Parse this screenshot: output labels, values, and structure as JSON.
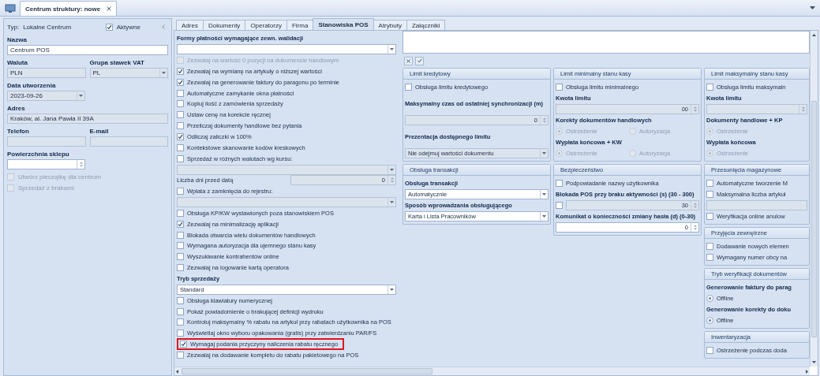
{
  "window": {
    "document_tab": "Centrum struktury: nowe"
  },
  "sidebar": {
    "type_label": "Typ:",
    "type_value": "Lokalne Centrum",
    "active": {
      "label": "Aktywne",
      "checked": true
    },
    "rows": [
      [
        {
          "kind": "text",
          "label": "Nazwa",
          "value": "Centrum POS",
          "disabled": false
        }
      ],
      [
        {
          "kind": "text",
          "label": "Waluta",
          "value": "PLN",
          "disabled": true
        },
        {
          "kind": "dropdown",
          "label": "Grupa stawek VAT",
          "value": "PL",
          "disabled": true
        }
      ],
      [
        {
          "kind": "date",
          "label": "Data utworzenia",
          "value": "2023-09-26",
          "disabled": true
        }
      ],
      [
        {
          "kind": "text",
          "label": "Adres",
          "value": "Kraków, al. Jana Pawła II 39A",
          "disabled": true
        }
      ],
      [
        {
          "kind": "text",
          "label": "Telefon",
          "disabled": true
        },
        {
          "kind": "text",
          "label": "E-mail",
          "disabled": true
        }
      ],
      [
        {
          "kind": "spinner",
          "label": "Powierzchnia sklepu",
          "disabled": false
        }
      ]
    ],
    "checkboxes": [
      {
        "label": "Utwórz pieczątkę dla centrum",
        "checked": false,
        "disabled": true
      },
      {
        "label": "Sprzedaż z brakami",
        "checked": false,
        "disabled": true
      }
    ]
  },
  "tabs": [
    {
      "label": "Adres",
      "selected": false
    },
    {
      "label": "Dokumenty",
      "selected": false
    },
    {
      "label": "Operatorzy",
      "selected": false
    },
    {
      "label": "Firma",
      "selected": false
    },
    {
      "label": "Stanowiska POS",
      "selected": true
    },
    {
      "label": "Atrybuty",
      "selected": false
    },
    {
      "label": "Załączniki",
      "selected": false
    }
  ],
  "settings": [
    {
      "kind": "label",
      "text": "Formy płatności wymagające zewn. walidacji"
    },
    {
      "kind": "dropdown",
      "disabled": false
    },
    {
      "kind": "checkbox",
      "label": "Zezwalaj na wartość 0 pozycji na dokumencie handlowym",
      "checked": false,
      "disabled": true,
      "highlighted": false
    },
    {
      "kind": "checkbox",
      "label": "Zezwalaj na wymianę na artykuły o niższej wartości",
      "checked": true,
      "disabled": false,
      "highlighted": false
    },
    {
      "kind": "checkbox",
      "label": "Zezwalaj na generowanie faktury do paragonu po terminie",
      "checked": true,
      "disabled": false,
      "highlighted": false
    },
    {
      "kind": "checkbox",
      "label": "Automatyczne zamykanie okna płatności",
      "checked": false,
      "disabled": false,
      "highlighted": false
    },
    {
      "kind": "checkbox",
      "label": "Kopiuj ilość z zamówienia sprzedaży",
      "checked": false,
      "disabled": false,
      "highlighted": false
    },
    {
      "kind": "checkbox",
      "label": "Ustaw cenę na korekcie ręcznej",
      "checked": false,
      "disabled": false,
      "highlighted": false
    },
    {
      "kind": "checkbox",
      "label": "Przeliczaj dokumenty handlowe bez pytania",
      "checked": false,
      "disabled": false,
      "highlighted": false
    },
    {
      "kind": "checkbox",
      "label": "Odliczaj zaliczki w 100%",
      "checked": true,
      "disabled": false,
      "highlighted": false
    },
    {
      "kind": "checkbox",
      "label": "Kontekstowe skanowanie kodów kreskowych",
      "checked": false,
      "disabled": false,
      "highlighted": false
    },
    {
      "kind": "checkbox",
      "label": "Sprzedaż w różnych walutach wg kursu:",
      "checked": false,
      "disabled": false,
      "highlighted": false
    },
    {
      "kind": "dropdown",
      "disabled": true
    },
    {
      "kind": "number",
      "label": "Liczba dni przed datą",
      "value": "0",
      "disabled": true
    },
    {
      "kind": "checkbox",
      "label": "Wpłata z zamknięcia do rejestru:",
      "checked": false,
      "disabled": false,
      "highlighted": false
    },
    {
      "kind": "dropdown",
      "disabled": true
    },
    {
      "kind": "checkbox",
      "label": "Obsługa KP/KW wystawionych poza stanowiskiem POS",
      "checked": false,
      "disabled": false,
      "highlighted": false
    },
    {
      "kind": "checkbox",
      "label": "Zezwalaj na minimalizację aplikacji",
      "checked": true,
      "disabled": false,
      "highlighted": false
    },
    {
      "kind": "checkbox",
      "label": "Blokada otwarcia wielu dokumentów handlowych",
      "checked": false,
      "disabled": false,
      "highlighted": false
    },
    {
      "kind": "checkbox",
      "label": "Wymagana autoryzacja dla ujemnego stanu kasy",
      "checked": false,
      "disabled": false,
      "highlighted": false
    },
    {
      "kind": "checkbox",
      "label": "Wyszukiwanie kontrahentów online",
      "checked": false,
      "disabled": false,
      "highlighted": false
    },
    {
      "kind": "checkbox",
      "label": "Zezwalaj na logowanie kartą operatora",
      "checked": false,
      "disabled": false,
      "highlighted": false
    },
    {
      "kind": "label",
      "text": "Tryb sprzedaży"
    },
    {
      "kind": "dropdown",
      "value": "Standard",
      "disabled": false
    },
    {
      "kind": "checkbox",
      "label": "Obsługa klawiatury numerycznej",
      "checked": false,
      "disabled": false,
      "highlighted": false
    },
    {
      "kind": "checkbox",
      "label": "Pokaż powiadomienie o brakującej definicji wydruku",
      "checked": false,
      "disabled": false,
      "highlighted": false
    },
    {
      "kind": "checkbox",
      "label": "Kontroluj maksymalny % rabatu na artykuł przy rabatach użytkownika na POS",
      "checked": false,
      "disabled": false,
      "highlighted": false
    },
    {
      "kind": "checkbox",
      "label": "Wyświetlaj okno wyboru opakowania (gratis) przy zatwierdzaniu PAR/FS",
      "checked": false,
      "disabled": false,
      "highlighted": false
    },
    {
      "kind": "checkbox",
      "label": "Wymagaj podania przyczyny naliczenia rabatu ręcznego",
      "checked": true,
      "disabled": false,
      "highlighted": true
    },
    {
      "kind": "checkbox",
      "label": "Zezwalaj na dodawanie kompletu do rabatu pakietowego na POS",
      "checked": false,
      "disabled": false,
      "highlighted": false
    }
  ],
  "group_rows": [
    [
      [
        {
          "title": "Limit kredytowy",
          "items": [
            {
              "kind": "checkbox",
              "label": "Obsługa limitu kredytowego",
              "checked": false
            },
            {
              "kind": "label",
              "text": "Maksymalny czas od ostatniej synchronizacji (m)"
            },
            {
              "kind": "spinner",
              "value": "0",
              "disabled": true
            },
            {
              "kind": "label",
              "text": "Prezentacja dostępnego limitu"
            },
            {
              "kind": "dropdown",
              "value": "Nie odejmuj wartości dokumentu",
              "disabled": true
            }
          ]
        }
      ],
      [
        {
          "title": "Limit minimalny stanu kasy",
          "items": [
            {
              "kind": "checkbox",
              "label": "Obsługa limitu minimalnego",
              "checked": false
            },
            {
              "kind": "label",
              "text": "Kwota limitu"
            },
            {
              "kind": "spinner",
              "value": "00",
              "disabled": true
            },
            {
              "kind": "label",
              "text": "Korekty dokumentów handlowych"
            },
            {
              "kind": "radios",
              "disabled": true,
              "options": [
                {
                  "label": "Ostrzeżenie",
                  "selected": true
                },
                {
                  "label": "Autoryzacja",
                  "selected": false
                }
              ]
            },
            {
              "kind": "label",
              "text": "Wypłata końcowa + KW"
            },
            {
              "kind": "radios",
              "disabled": true,
              "options": [
                {
                  "label": "Ostrzeżenie",
                  "selected": true
                },
                {
                  "label": "Autoryzacja",
                  "selected": false
                }
              ]
            }
          ]
        }
      ],
      [
        {
          "title": "Limit maksymalny stanu kasy",
          "items": [
            {
              "kind": "checkbox",
              "label": "Obsługa limitu maksymaln",
              "checked": false
            },
            {
              "kind": "label",
              "text": "Kwota limitu"
            },
            {
              "kind": "spinner",
              "disabled": true
            },
            {
              "kind": "label",
              "text": "Dokumenty handlowe + KP"
            },
            {
              "kind": "radios",
              "disabled": true,
              "options": [
                {
                  "label": "Ostrzeżenie",
                  "selected": true
                }
              ]
            },
            {
              "kind": "label",
              "text": "Wypłata końcowa"
            },
            {
              "kind": "radios",
              "disabled": true,
              "options": [
                {
                  "label": "Ostrzeżenie",
                  "selected": true
                }
              ]
            }
          ]
        }
      ]
    ],
    [
      [
        {
          "title": "Obsługa transakcji",
          "items": [
            {
              "kind": "label",
              "text": "Obsługa transakcji"
            },
            {
              "kind": "dropdown",
              "value": "Automatycznie",
              "disabled": false
            },
            {
              "kind": "label",
              "text": "Sposób wprowadzania obsługującego"
            },
            {
              "kind": "dropdown",
              "value": "Karta i Lista Pracowników",
              "disabled": false
            }
          ]
        }
      ],
      [
        {
          "title": "Bezpieczeństwo",
          "items": [
            {
              "kind": "checkbox",
              "label": "Podpowiadanie nazwy użytkownika",
              "checked": false
            },
            {
              "kind": "label",
              "text": "Blokada POS przy braku aktywności (s) (30 - 300)"
            },
            {
              "kind": "spinner",
              "value": "30",
              "disabled": true,
              "checkbox": {
                "checked": false
              }
            },
            {
              "kind": "label",
              "text": "Komunikat o konieczności zmiany hasła (d) (0-30)"
            },
            {
              "kind": "spinner",
              "value": "0",
              "disabled": false
            }
          ]
        }
      ],
      [
        {
          "title": "Przesunięcia magazynowe",
          "items": [
            {
              "kind": "checkbox",
              "label": "Automatyczne tworzenie M",
              "checked": false
            },
            {
              "kind": "checkbox",
              "label": "Maksymalna liczba artykuł",
              "checked": false
            },
            {
              "kind": "field",
              "disabled": true
            },
            {
              "kind": "checkbox",
              "label": "Weryfikacja online anulow",
              "checked": false
            }
          ]
        },
        {
          "title": "Przyjęcia zewnętrzne",
          "items": [
            {
              "kind": "checkbox",
              "label": "Dodawanie nowych elemen",
              "checked": false
            },
            {
              "kind": "checkbox",
              "label": "Wymagany numer obcy na",
              "checked": false
            }
          ]
        },
        {
          "title": "Tryb weryfikacji dokumentów",
          "items": [
            {
              "kind": "label",
              "text": "Generowanie faktury do parag"
            },
            {
              "kind": "radios",
              "disabled": false,
              "options": [
                {
                  "label": "Offline",
                  "selected": true
                }
              ]
            },
            {
              "kind": "label",
              "text": "Generowanie korekty do doku"
            },
            {
              "kind": "radios",
              "disabled": false,
              "options": [
                {
                  "label": "Offline",
                  "selected": true
                }
              ]
            }
          ]
        },
        {
          "title": "Inwentaryzacja",
          "items": [
            {
              "kind": "checkbox",
              "label": "Ostrzeżenie podczas doda",
              "checked": false
            }
          ]
        }
      ]
    ]
  ]
}
